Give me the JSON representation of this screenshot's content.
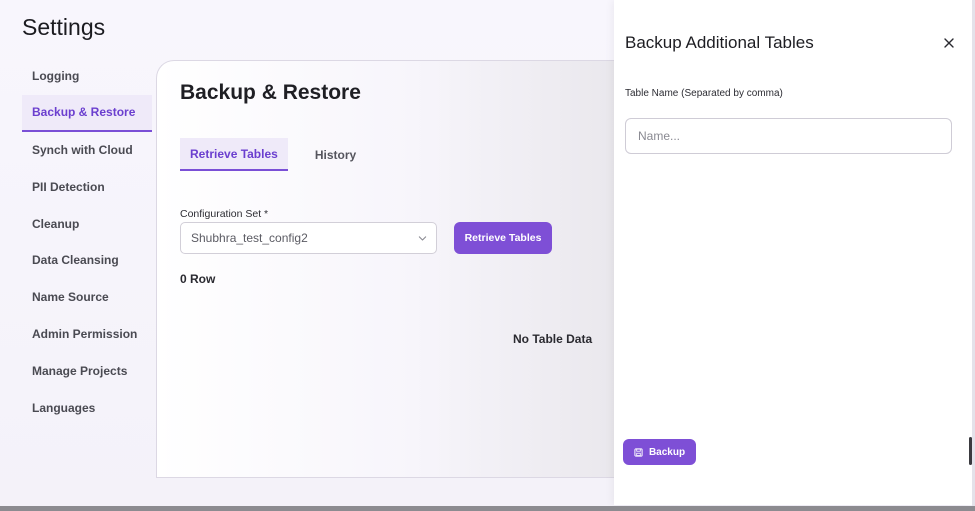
{
  "page": {
    "title": "Settings"
  },
  "sidebar": {
    "items": [
      {
        "label": "Logging"
      },
      {
        "label": "Backup & Restore"
      },
      {
        "label": "Synch with Cloud"
      },
      {
        "label": "PII Detection"
      },
      {
        "label": "Cleanup"
      },
      {
        "label": "Data Cleansing"
      },
      {
        "label": "Name Source"
      },
      {
        "label": "Admin Permission"
      },
      {
        "label": "Manage Projects"
      },
      {
        "label": "Languages"
      }
    ],
    "active_index": 1
  },
  "main": {
    "title": "Backup & Restore",
    "tabs": [
      {
        "label": "Retrieve Tables"
      },
      {
        "label": "History"
      }
    ],
    "config_label": "Configuration Set *",
    "config_value": "Shubhra_test_config2",
    "retrieve_button": "Retrieve Tables",
    "row_count": "0 Row",
    "empty_message": "No Table Data"
  },
  "drawer": {
    "title": "Backup Additional Tables",
    "field_label": "Table Name (Separated by comma)",
    "field_placeholder": "Name...",
    "backup_button": "Backup",
    "close_icon": "close-icon",
    "backup_icon": "save-icon"
  },
  "colors": {
    "accent": "#7e4fd6",
    "accent_text": "#6b3fcf",
    "active_bg": "#efeaf9"
  }
}
